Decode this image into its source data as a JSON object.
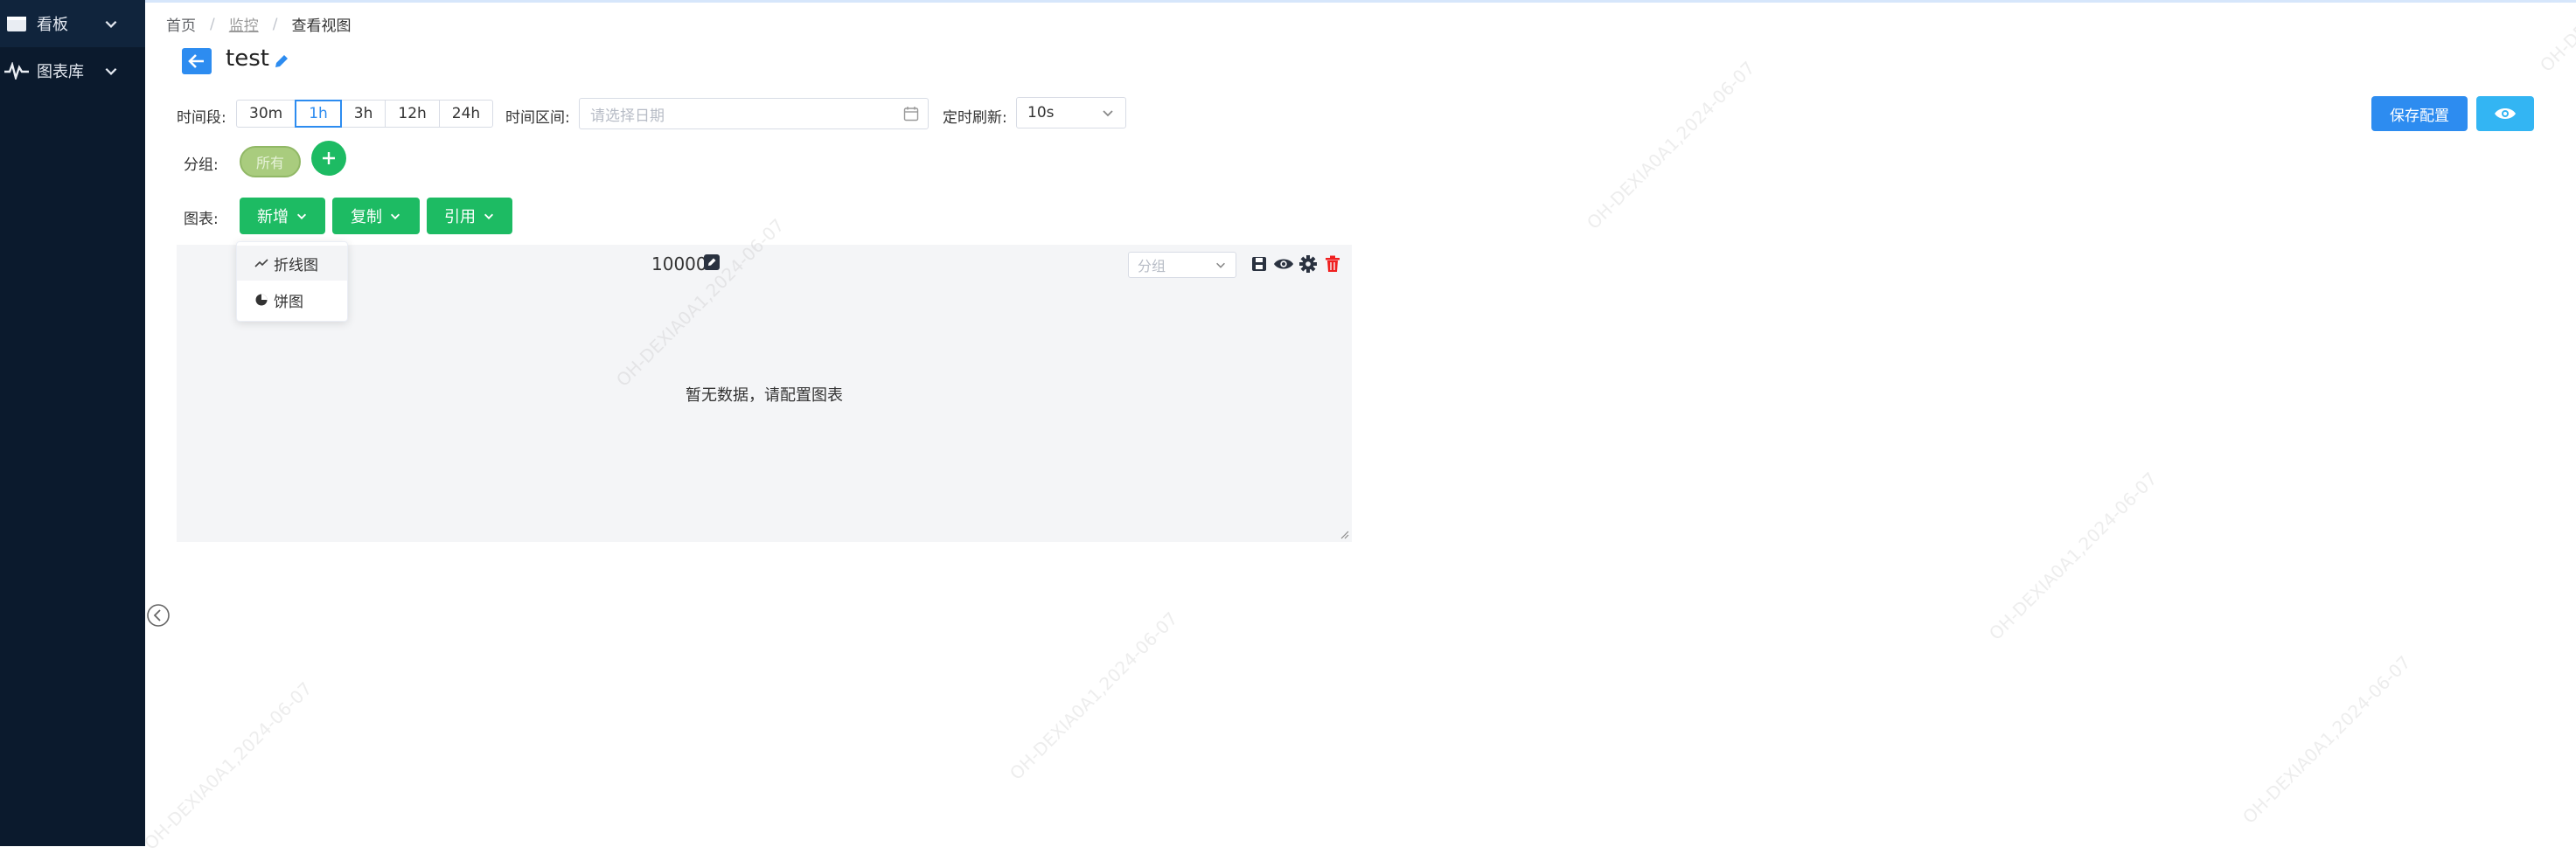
{
  "sidebar": {
    "items": [
      {
        "label": "看板",
        "icon": "dashboard-icon"
      },
      {
        "label": "图表库",
        "icon": "pulse-icon"
      }
    ]
  },
  "breadcrumb": {
    "home": "首页",
    "section": "监控",
    "current": "查看视图",
    "separator": "/"
  },
  "header": {
    "title": "test"
  },
  "toolbar": {
    "period_label": "时间段:",
    "periods": [
      "30m",
      "1h",
      "3h",
      "12h",
      "24h"
    ],
    "active_period": "1h",
    "range_label": "时间区间:",
    "range_placeholder": "请选择日期",
    "refresh_label": "定时刷新:",
    "refresh_value": "10s",
    "save_label": "保存配置"
  },
  "group": {
    "label": "分组:",
    "tag": "所有"
  },
  "chart_toolbar": {
    "label": "图表:",
    "add_label": "新增",
    "copy_label": "复制",
    "ref_label": "引用",
    "dropdown": [
      {
        "label": "折线图",
        "icon": "line-chart-icon"
      },
      {
        "label": "饼图",
        "icon": "pie-chart-icon"
      }
    ]
  },
  "panel": {
    "title": "10000",
    "group_placeholder": "分组",
    "empty_text": "暂无数据，请配置图表"
  },
  "watermark": "OH-DEXIA0A1,2024-06-07",
  "colors": {
    "primary": "#2d8cf0",
    "success": "#1dbb63",
    "sidebar": "#0b1a2d",
    "danger": "#f02020"
  }
}
